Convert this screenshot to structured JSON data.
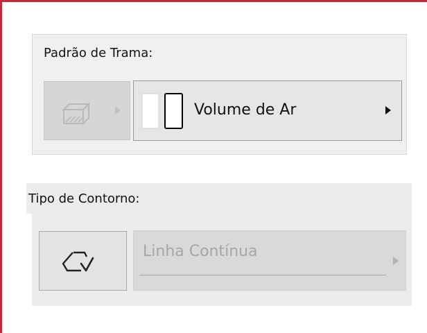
{
  "fill_pattern": {
    "label": "Padrão de Trama:",
    "swatch_icon": "hatch-fill-icon",
    "value": "Volume de Ar",
    "preview_icon": "fill-preview-icon",
    "arrow_icon": "triangle-right-icon"
  },
  "outline_type": {
    "label": "Tipo de Contorno:",
    "icon": "outline-check-icon",
    "value": "Linha Contínua",
    "arrow_icon": "triangle-right-icon"
  },
  "colors": {
    "frame_border": "#c8283a",
    "panel_bg": "#f0f0f0",
    "disabled_text": "#a6a6a6"
  }
}
